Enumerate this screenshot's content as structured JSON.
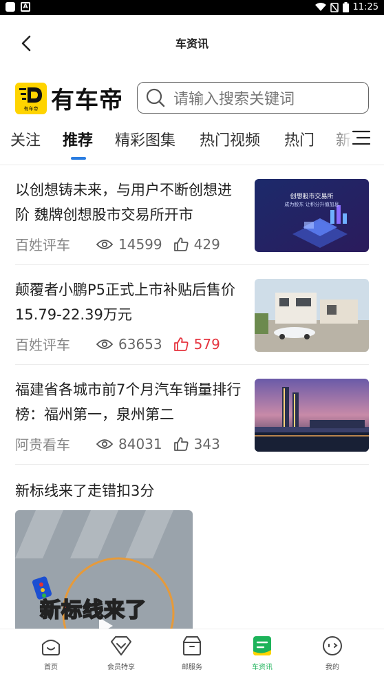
{
  "status_bar": {
    "time": "11:25"
  },
  "header": {
    "title": "车资讯",
    "back_icon": "chevron-left-icon"
  },
  "brand": {
    "name": "有车帝",
    "logo_caption": "有车帝",
    "accent": "#ffd400"
  },
  "search": {
    "placeholder": "请输入搜索关键词"
  },
  "tabs": [
    {
      "label": "关注"
    },
    {
      "label": "推荐",
      "active": true
    },
    {
      "label": "精彩图集"
    },
    {
      "label": "热门视频"
    },
    {
      "label": "热门"
    },
    {
      "label": "新"
    }
  ],
  "articles": [
    {
      "headline": "以创想铸未来，与用户不断创想进阶 魏牌创想股市交易所开市",
      "source": "百姓评车",
      "views": "14599",
      "likes": "429",
      "liked": false,
      "thumb_caption": "创想股市交易所",
      "thumb_sub": "成为股东 让积分升值加息"
    },
    {
      "headline": "颠覆者小鹏P5正式上市补贴后售价15.79-22.39万元",
      "source": "百姓评车",
      "views": "63653",
      "likes": "579",
      "liked": true
    },
    {
      "headline": "福建省各城市前7个月汽车销量排行榜：福州第一，泉州第二",
      "source": "阿贵看车",
      "views": "84031",
      "likes": "343",
      "liked": false
    }
  ],
  "video": {
    "title": "新标线来了走错扣3分",
    "overlay_text": "新标线来了"
  },
  "bottom_nav": [
    {
      "label": "首页",
      "icon": "home-face-icon"
    },
    {
      "label": "会员特享",
      "icon": "member-diamond-icon"
    },
    {
      "label": "邮服务",
      "icon": "mail-box-icon"
    },
    {
      "label": "车资讯",
      "icon": "news-icon",
      "active": true
    },
    {
      "label": "我的",
      "icon": "profile-face-icon"
    }
  ],
  "colors": {
    "accent_blue": "#2a7de1",
    "active_green": "#1db35a",
    "like_red": "#e5343f"
  }
}
